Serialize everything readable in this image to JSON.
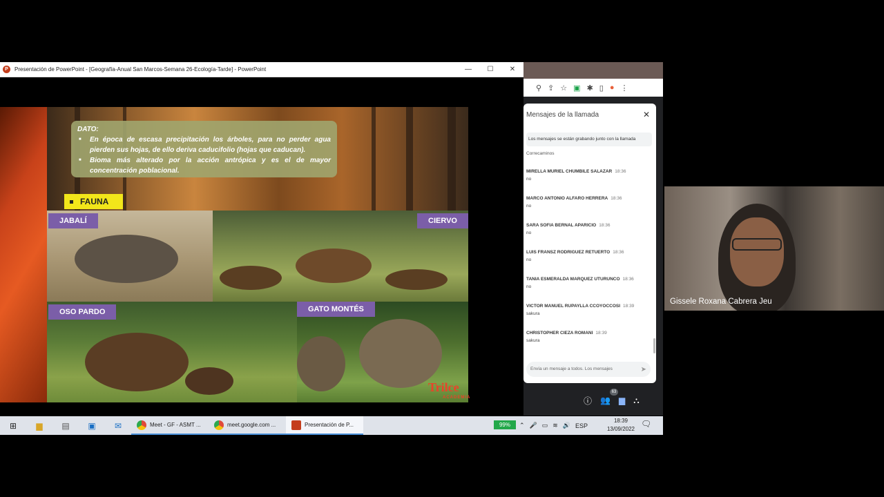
{
  "ppt": {
    "window_title": "Presentación de PowerPoint - [Geografía-Anual San Marcos-Semana 26-Ecología-Tarde] - PowerPoint",
    "minimize": "—",
    "maximize": "☐",
    "close": "✕"
  },
  "slide": {
    "dato_title": "DATO:",
    "dato_items": [
      "En época de escasa precipitación los árboles, para no perder agua pierden sus hojas, de ello deriva caducifolio (hojas que caducan).",
      "Bioma más alterado por la acción antrópica y es el de mayor concentración poblacional."
    ],
    "fauna_label": "FAUNA",
    "animals": {
      "boar": "JABALÍ",
      "deer": "CIERVO",
      "bear": "OSO PARDO",
      "cat": "GATO MONTÉS"
    },
    "brand": "Trilce",
    "brand_sub": "ACADEMIA"
  },
  "chat": {
    "title": "Mensajes de la llamada",
    "recording_note": "Los mensajes se están grabando junto con la llamada",
    "prev_text": "Correcaminos",
    "messages": [
      {
        "name": "MIRELLA MURIEL CHUMBILE SALAZAR",
        "time": "18:36",
        "text": "no"
      },
      {
        "name": "MARCO ANTONIO ALFARO HERRERA",
        "time": "18:36",
        "text": "no"
      },
      {
        "name": "SARA SOFIA BERNAL APARICIO",
        "time": "18:36",
        "text": "no"
      },
      {
        "name": "LUIS FRANSZ RODRIGUEZ RETUERTO",
        "time": "18:36",
        "text": "no"
      },
      {
        "name": "TANIA ESMERALDA MARQUEZ UTURUNCO",
        "time": "18:36",
        "text": "no"
      },
      {
        "name": "VICTOR MANUEL RUPAYLLA CCOYOCCOSI",
        "time": "18:39",
        "text": "sakura"
      },
      {
        "name": "CHRISTOPHER CIEZA ROMANI",
        "time": "18:39",
        "text": "sakura"
      }
    ],
    "input_placeholder": "Envía un mensaje a todos. Los mensajes",
    "participants_count": "63"
  },
  "video": {
    "participant_name": "Gissele Roxana Cabrera Jeu"
  },
  "taskbar": {
    "apps": [
      {
        "label": "Meet - GF - ASMT ...",
        "color": "#e04a3a"
      },
      {
        "label": "meet.google.com ...",
        "color": "#e04a3a"
      },
      {
        "label": "Presentación de P...",
        "color": "#c43e1c"
      }
    ],
    "battery": "99%",
    "language": "ESP",
    "time": "18:39",
    "date": "13/09/2022",
    "notifications": "2"
  }
}
